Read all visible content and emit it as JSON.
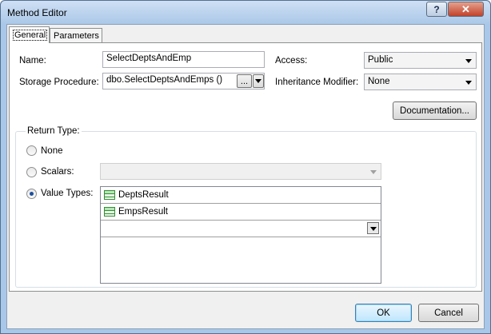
{
  "window": {
    "title": "Method Editor",
    "help_glyph": "?",
    "close_glyph": "✕"
  },
  "tabs": [
    {
      "label": "General",
      "active": true
    },
    {
      "label": "Parameters",
      "active": false
    }
  ],
  "form": {
    "name_label": "Name:",
    "name_value": "SelectDeptsAndEmp",
    "access_label": "Access:",
    "access_value": "Public",
    "storage_label": "Storage Procedure:",
    "storage_value": "dbo.SelectDeptsAndEmps ()",
    "storage_browse_label": "...",
    "inheritance_label": "Inheritance Modifier:",
    "inheritance_value": "None",
    "documentation_button": "Documentation..."
  },
  "return_type": {
    "group_label": "Return Type:",
    "options": [
      {
        "label": "None",
        "checked": false
      },
      {
        "label": "Scalars:",
        "checked": false
      },
      {
        "label": "Value Types:",
        "checked": true
      }
    ],
    "scalars_value": "",
    "value_types": [
      {
        "label": "DeptsResult",
        "icon": "table-icon"
      },
      {
        "label": "EmpsResult",
        "icon": "table-icon"
      }
    ],
    "new_row_value": ""
  },
  "footer": {
    "ok_label": "OK",
    "cancel_label": "Cancel"
  },
  "colors": {
    "title_bar": "#a9c7e8",
    "close_button": "#c2422a",
    "selected_radio": "#1c4f9c"
  }
}
